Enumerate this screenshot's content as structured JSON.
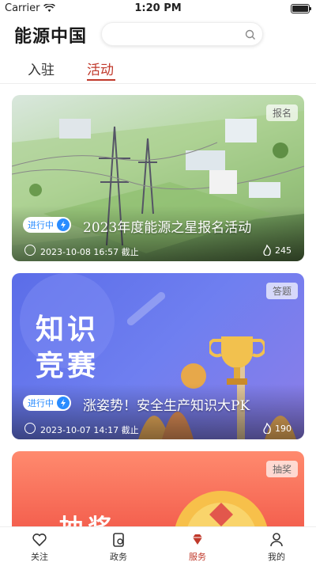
{
  "status_bar": {
    "carrier": "Carrier",
    "time": "1:20 PM"
  },
  "header": {
    "logo": "能源中国",
    "search_placeholder": ""
  },
  "tabs": [
    {
      "label": "入驻"
    },
    {
      "label": "活动"
    }
  ],
  "cards": [
    {
      "tag": "报名",
      "status": "进行中",
      "title": "2023年度能源之星报名活动",
      "date": "2023-10-08 16:57 截止",
      "count": "245"
    },
    {
      "tag": "答题",
      "status": "进行中",
      "title": "涨姿势！安全生产知识大PK",
      "date": "2023-10-07 14:17 截止",
      "count": "190",
      "banner_line1": "知识",
      "banner_line2": "竞赛"
    },
    {
      "tag": "抽奖",
      "banner_text": "抽奖"
    }
  ],
  "tabbar": [
    {
      "label": "关注"
    },
    {
      "label": "政务"
    },
    {
      "label": "服务"
    },
    {
      "label": "我的"
    }
  ],
  "colors": {
    "accent": "#c0392b",
    "status_blue": "#2a8cff"
  }
}
